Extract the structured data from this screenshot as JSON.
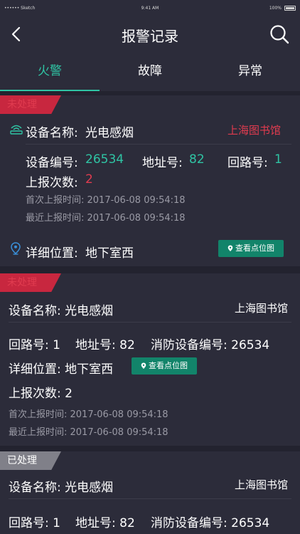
{
  "status_bar": {
    "carrier": "•••••• Sketch",
    "time": "9:41 AM",
    "battery": "100%"
  },
  "nav": {
    "title": "报警记录"
  },
  "tabs": [
    "火警",
    "故障",
    "异常"
  ],
  "cards": [
    {
      "status": "未处理",
      "device_name_label": "设备名称:",
      "device_name": "光电感烟",
      "location": "上海图书馆",
      "device_no_label": "设备编号:",
      "device_no": "26534",
      "address_label": "地址号:",
      "address": "82",
      "loop_label": "回路号:",
      "loop": "1",
      "report_count_label": "上报次数:",
      "report_count": "2",
      "first_report": "首次上报时间:   2017-06-08 09:54:18",
      "last_report": "最近上报时间:   2017-06-08 09:54:18",
      "detail_label": "详细位置:",
      "detail": "地下室西",
      "map_button": "查看点位图"
    },
    {
      "status": "未处理",
      "device_name": "设备名称:  光电感烟",
      "location": "上海图书馆",
      "loop": "回路号:  1",
      "address": "地址号:  82",
      "fire_device_no": "消防设备编号:  26534",
      "detail": "详细位置:  地下室西",
      "map_button": "查看点位图",
      "report_count": "上报次数:  2",
      "first_report": "首次上报时间:   2017-06-08 09:54:18",
      "last_report": "最近上报时间:   2017-06-08 09:54:18"
    },
    {
      "status": "已处理",
      "device_name": "设备名称:  光电感烟",
      "location": "上海图书馆",
      "loop": "回路号:  1",
      "address": "地址号:  82",
      "fire_device_no": "消防设备编号:  26534"
    }
  ],
  "colors": {
    "accent": "#2fc4a4",
    "alert": "#e03b4f",
    "badge_unhandled": "#c8273f",
    "badge_handled": "#808089",
    "map_button": "#12846a"
  },
  "icons": {
    "back": "chevron-left-icon",
    "search": "search-icon",
    "device": "smoke-detector-icon",
    "location": "map-pin-icon"
  }
}
